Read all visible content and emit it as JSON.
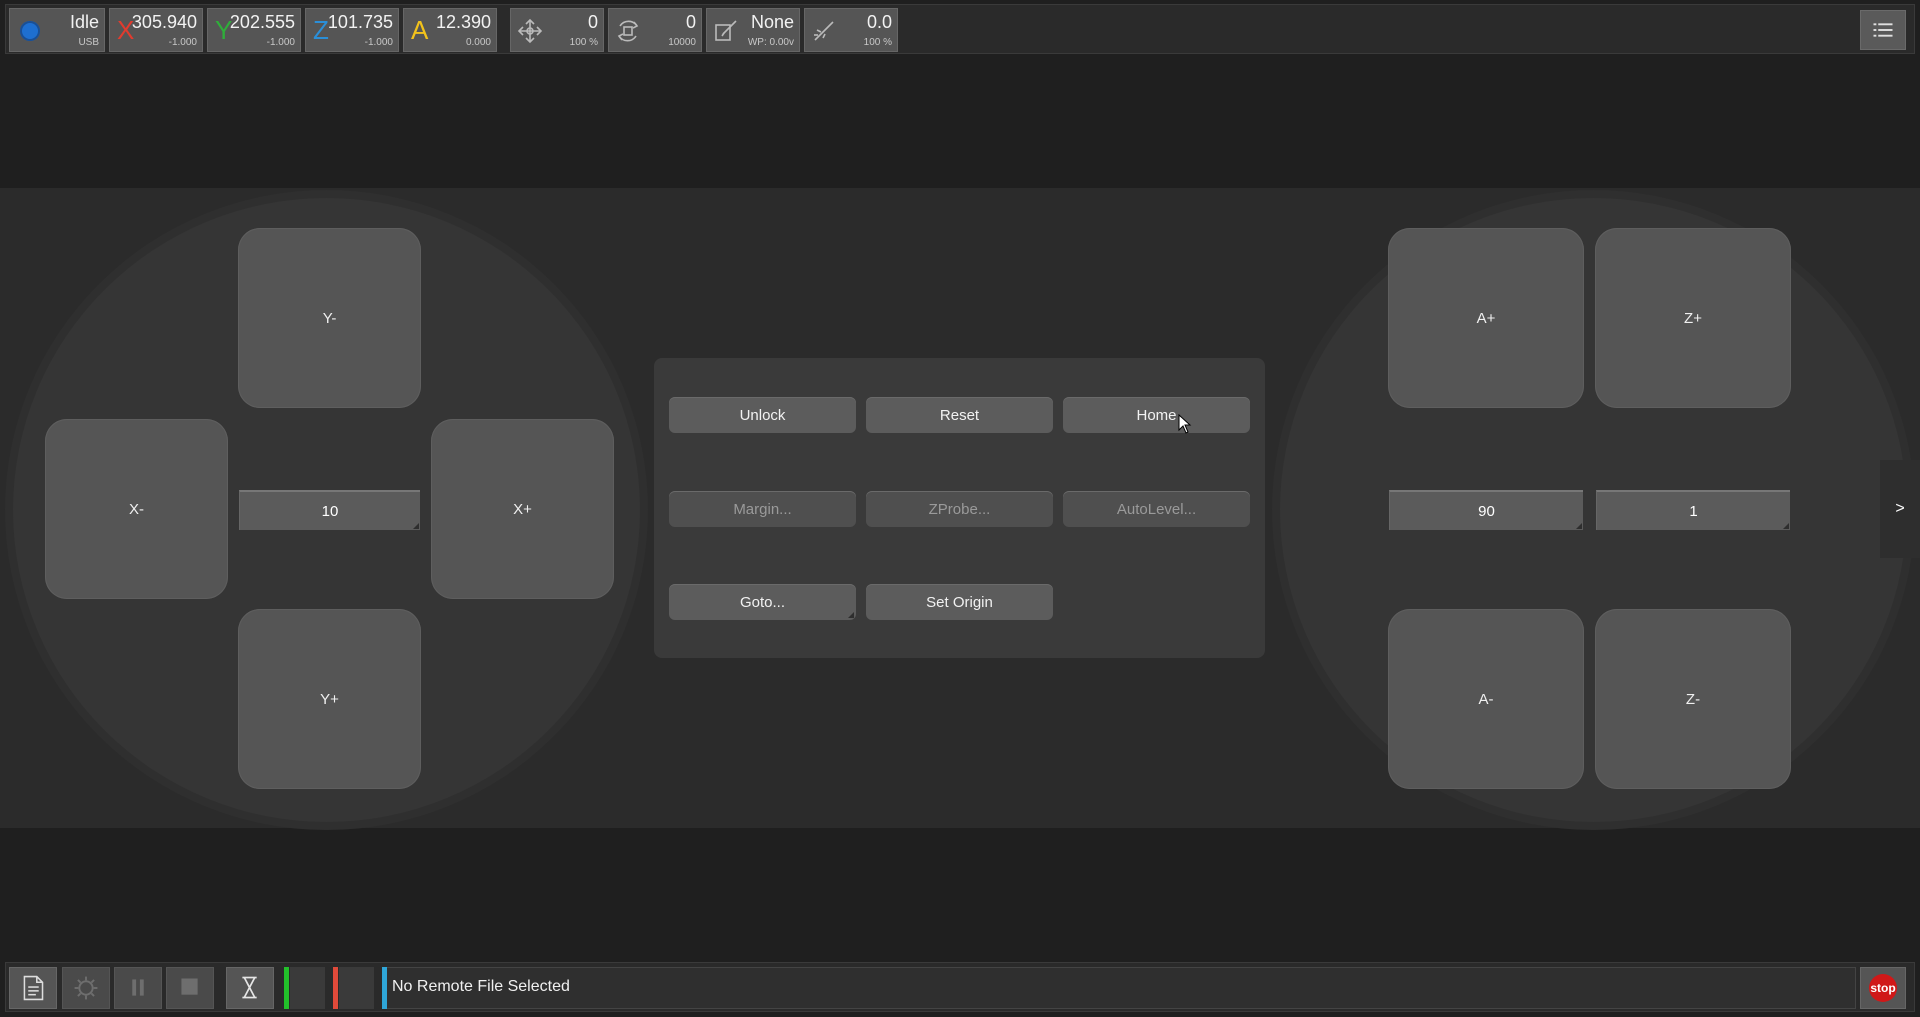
{
  "status": {
    "state": "Idle",
    "connection": "USB",
    "indicator_color": "#1e6fd0"
  },
  "axes": [
    {
      "letter": "X",
      "value": "305.940",
      "offset": "-1.000",
      "color": "#e23b2e"
    },
    {
      "letter": "Y",
      "value": "202.555",
      "offset": "-1.000",
      "color": "#2fae3a"
    },
    {
      "letter": "Z",
      "value": "101.735",
      "offset": "-1.000",
      "color": "#2b8fd8"
    },
    {
      "letter": "A",
      "value": "12.390",
      "offset": "0.000",
      "color": "#f2c21b"
    }
  ],
  "feed": {
    "icon": "move-arrows-icon",
    "value": "0",
    "override": "100 %"
  },
  "spindle": {
    "icon": "spindle-icon",
    "value": "0",
    "max": "10000"
  },
  "tool": {
    "icon": "tool-edit-icon",
    "value": "None",
    "wp": "WP: 0.00v"
  },
  "laser": {
    "icon": "laser-icon",
    "value": "0.0",
    "override": "100 %"
  },
  "jog": {
    "y_minus": "Y-",
    "y_plus": "Y+",
    "x_minus": "X-",
    "x_plus": "X+",
    "xy_step": "10",
    "a_plus": "A+",
    "a_minus": "A-",
    "z_plus": "Z+",
    "z_minus": "Z-",
    "a_step": "90",
    "z_step": "1"
  },
  "controls": {
    "unlock": "Unlock",
    "reset": "Reset",
    "home": "Home",
    "margin": "Margin...",
    "zprobe": "ZProbe...",
    "autolevel": "AutoLevel...",
    "goto": "Goto...",
    "set_origin": "Set Origin"
  },
  "side_tab": ">",
  "bottom": {
    "file_status": "No Remote File Selected",
    "stop_label": "stop",
    "progress_colors": {
      "green": "#22c02a",
      "red": "#e04a3a",
      "blue": "#2fa6d8"
    }
  }
}
